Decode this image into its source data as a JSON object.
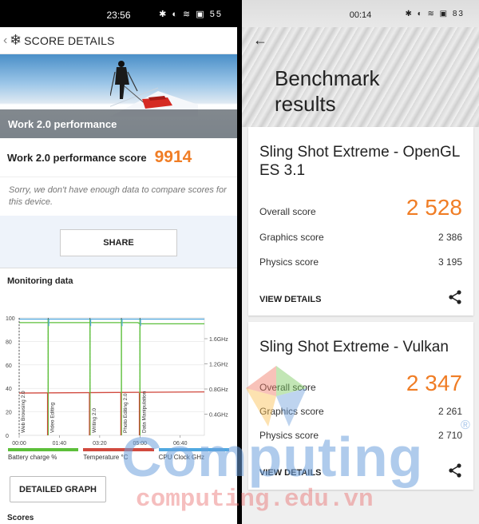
{
  "left": {
    "status": {
      "time": "23:56",
      "icons": "✱ ◐ ≋ ▣ 55"
    },
    "appbar": {
      "back_icon": "‹",
      "logo_icon": "❄",
      "title": "SCORE DETAILS"
    },
    "hero": {
      "caption": "Work 2.0 performance"
    },
    "score": {
      "label": "Work 2.0 performance score",
      "value": "9914"
    },
    "note": "Sorry, we don't have enough data to compare scores for this device.",
    "share_label": "SHARE",
    "monitoring_title": "Monitoring data",
    "chart_data": {
      "type": "line",
      "x_ticks": [
        "00:00",
        "01:40",
        "03:20",
        "05:00",
        "06:40"
      ],
      "y_left_ticks": [
        "100",
        "80",
        "60",
        "40",
        "20",
        "0"
      ],
      "y_right_ticks": [
        "1.6GHz",
        "1.2GHz",
        "0.8GHz",
        "0.4GHz"
      ],
      "ylim": [
        0,
        100
      ],
      "xlim_seconds": [
        0,
        460
      ],
      "phases": [
        {
          "name": "Web Browsing 2.0",
          "start": 0
        },
        {
          "name": "Video Editing",
          "start": 72
        },
        {
          "name": "Writing 2.0",
          "start": 176
        },
        {
          "name": "Photo Editing 2.0",
          "start": 254
        },
        {
          "name": "Data Manipulation",
          "start": 300
        }
      ],
      "series": [
        {
          "name": "Battery charge %",
          "color": "#5cbf3a",
          "values": [
            [
              0,
              96
            ],
            [
              295,
              96
            ],
            [
              300,
              95
            ],
            [
              460,
              95
            ]
          ]
        },
        {
          "name": "Temperature °C",
          "color": "#d14a3f",
          "values": [
            [
              0,
              36
            ],
            [
              460,
              37
            ]
          ]
        },
        {
          "name": "CPU Clock GHz",
          "color": "#4fa8e0",
          "values": [
            [
              0,
              99
            ],
            [
              460,
              99
            ]
          ]
        }
      ]
    },
    "legend": [
      {
        "label": "Battery charge %",
        "color": "#5cbf3a"
      },
      {
        "label": "Temperature °C",
        "color": "#d14a3f"
      },
      {
        "label": "CPU Clock GHz",
        "color": "#4fa8e0"
      }
    ],
    "detailed_label": "DETAILED GRAPH",
    "scores_label": "Scores"
  },
  "right": {
    "status": {
      "time": "00:14",
      "icons": "✱ ◐ ≋ ▣ 83"
    },
    "back_icon": "←",
    "title": "Benchmark\nresults",
    "cards": [
      {
        "title": "Sling Shot Extreme - OpenGL ES 3.1",
        "overall_label": "Overall score",
        "overall_value": "2 528",
        "graphics_label": "Graphics score",
        "graphics_value": "2 386",
        "physics_label": "Physics score",
        "physics_value": "3 195",
        "view_label": "VIEW DETAILS"
      },
      {
        "title": "Sling Shot Extreme - Vulkan",
        "overall_label": "Overall score",
        "overall_value": "2 347",
        "graphics_label": "Graphics score",
        "graphics_value": "2 261",
        "physics_label": "Physics score",
        "physics_value": "2 710",
        "view_label": "VIEW DETAILS"
      }
    ]
  },
  "watermark": {
    "brand": "Computing",
    "reg": "®",
    "url": "computing.edu.vn"
  }
}
